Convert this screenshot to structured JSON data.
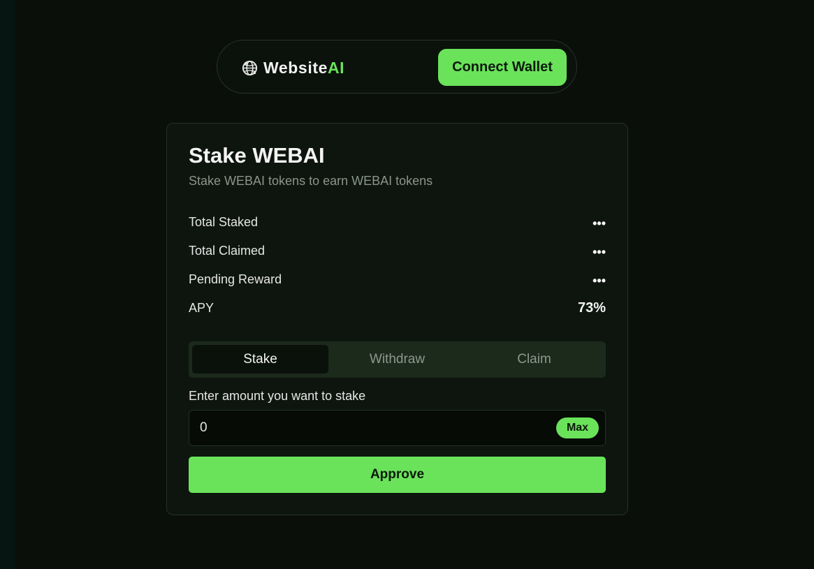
{
  "navbar": {
    "logo_text_main": "Website",
    "logo_text_accent": "AI",
    "logo_icon": "globe-icon",
    "connect_label": "Connect Wallet"
  },
  "card": {
    "title": "Stake WEBAI",
    "subtitle": "Stake WEBAI tokens to earn WEBAI tokens",
    "stats": [
      {
        "label": "Total Staked",
        "value": "•••"
      },
      {
        "label": "Total Claimed",
        "value": "•••"
      },
      {
        "label": "Pending Reward",
        "value": "•••"
      },
      {
        "label": "APY",
        "value": "73%"
      }
    ],
    "tabs": [
      {
        "label": "Stake",
        "active": true
      },
      {
        "label": "Withdraw",
        "active": false
      },
      {
        "label": "Claim",
        "active": false
      }
    ],
    "amount_label": "Enter amount you want to stake",
    "amount_value": "0",
    "max_label": "Max",
    "approve_label": "Approve"
  },
  "colors": {
    "accent": "#6ae35a",
    "background": "#0a0f0a",
    "card": "#0d150e",
    "tab_bar": "#1c2a1c"
  }
}
